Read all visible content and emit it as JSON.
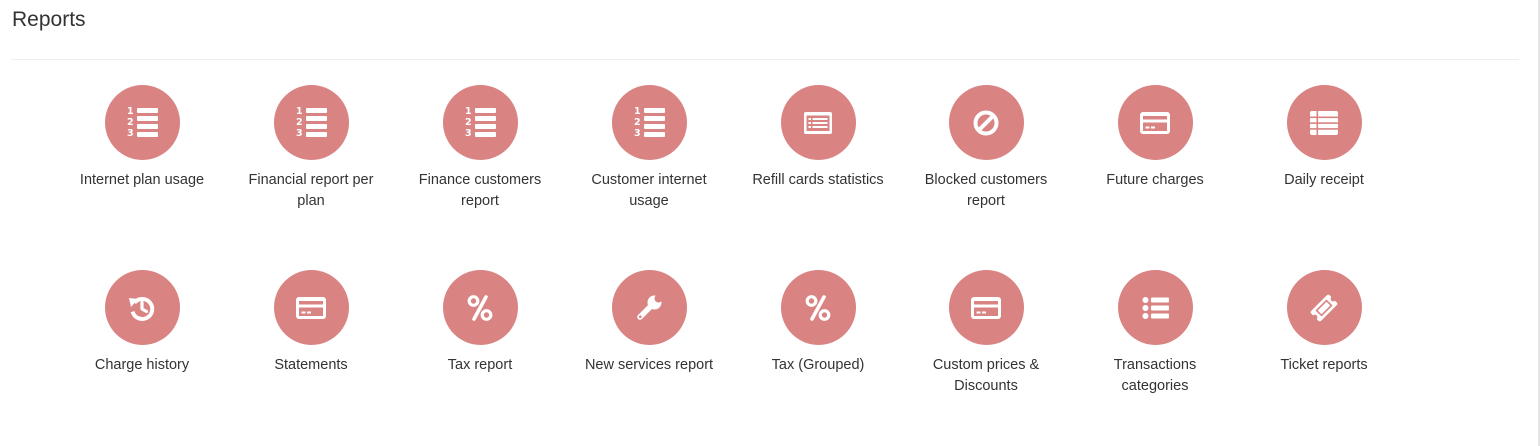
{
  "page": {
    "title": "Reports"
  },
  "colors": {
    "icon_background": "#d98383",
    "icon_foreground": "#ffffff",
    "divider": "#eeeeee"
  },
  "reports": [
    {
      "label": "Internet plan usage",
      "icon": "ordered-list-icon"
    },
    {
      "label": "Financial report per plan",
      "icon": "ordered-list-icon"
    },
    {
      "label": "Finance customers report",
      "icon": "ordered-list-icon"
    },
    {
      "label": "Customer internet usage",
      "icon": "ordered-list-icon"
    },
    {
      "label": "Refill cards statistics",
      "icon": "list-alt-icon"
    },
    {
      "label": "Blocked customers report",
      "icon": "ban-icon"
    },
    {
      "label": "Future charges",
      "icon": "credit-card-icon"
    },
    {
      "label": "Daily receipt",
      "icon": "list-icon"
    },
    {
      "label": "Charge history",
      "icon": "history-icon"
    },
    {
      "label": "Statements",
      "icon": "credit-card-icon"
    },
    {
      "label": "Tax report",
      "icon": "percent-icon"
    },
    {
      "label": "New services report",
      "icon": "wrench-icon"
    },
    {
      "label": "Tax (Grouped)",
      "icon": "percent-icon"
    },
    {
      "label": "Custom prices & Discounts",
      "icon": "credit-card-icon"
    },
    {
      "label": "Transactions categories",
      "icon": "list-ul-icon"
    },
    {
      "label": "Ticket reports",
      "icon": "ticket-icon"
    }
  ]
}
